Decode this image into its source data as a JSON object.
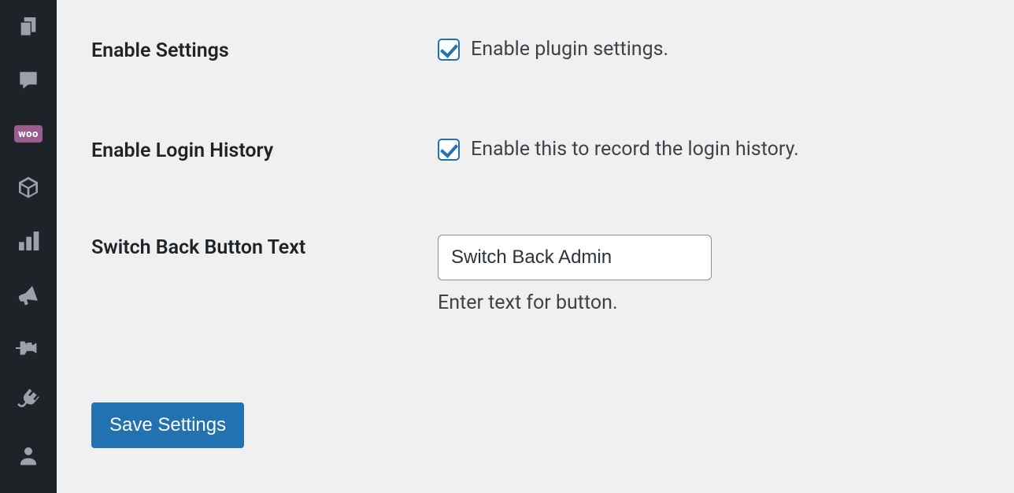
{
  "sidebar": {
    "items": [
      {
        "name": "layers-icon"
      },
      {
        "name": "comment-icon"
      },
      {
        "name": "woocommerce-icon",
        "text": "woo"
      },
      {
        "name": "box-icon"
      },
      {
        "name": "stats-icon"
      },
      {
        "name": "megaphone-icon"
      },
      {
        "name": "pin-icon"
      },
      {
        "name": "plugin-icon"
      },
      {
        "name": "user-icon"
      }
    ]
  },
  "settings": {
    "enable_settings": {
      "label": "Enable Settings",
      "checked": true,
      "description": "Enable plugin settings."
    },
    "enable_login_history": {
      "label": "Enable Login History",
      "checked": true,
      "description": "Enable this to record the login history."
    },
    "switch_back_button_text": {
      "label": "Switch Back Button Text",
      "value": "Switch Back Admin",
      "help": "Enter text for button."
    },
    "save_button": "Save Settings"
  }
}
